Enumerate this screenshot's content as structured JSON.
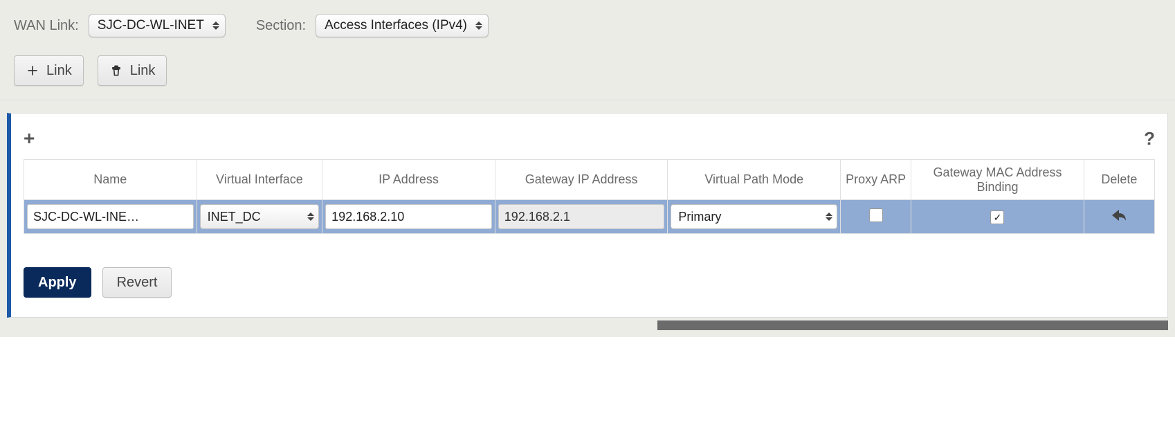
{
  "filters": {
    "wan_link_label": "WAN Link:",
    "wan_link_value": "SJC-DC-WL-INET",
    "section_label": "Section:",
    "section_value": "Access Interfaces (IPv4)"
  },
  "toolbar": {
    "add_link_label": "Link",
    "delete_link_label": "Link"
  },
  "table": {
    "headers": {
      "name": "Name",
      "virtual_interface": "Virtual Interface",
      "ip_address": "IP Address",
      "gateway_ip": "Gateway IP Address",
      "virtual_path_mode": "Virtual Path Mode",
      "proxy_arp": "Proxy ARP",
      "gateway_mac_binding": "Gateway MAC Address Binding",
      "delete": "Delete"
    },
    "rows": [
      {
        "name": "SJC-DC-WL-INE…",
        "virtual_interface": "INET_DC",
        "ip_address": "192.168.2.10",
        "gateway_ip": "192.168.2.1",
        "virtual_path_mode": "Primary",
        "proxy_arp_checked": false,
        "gateway_mac_binding_checked": true
      }
    ]
  },
  "buttons": {
    "apply": "Apply",
    "revert": "Revert"
  }
}
